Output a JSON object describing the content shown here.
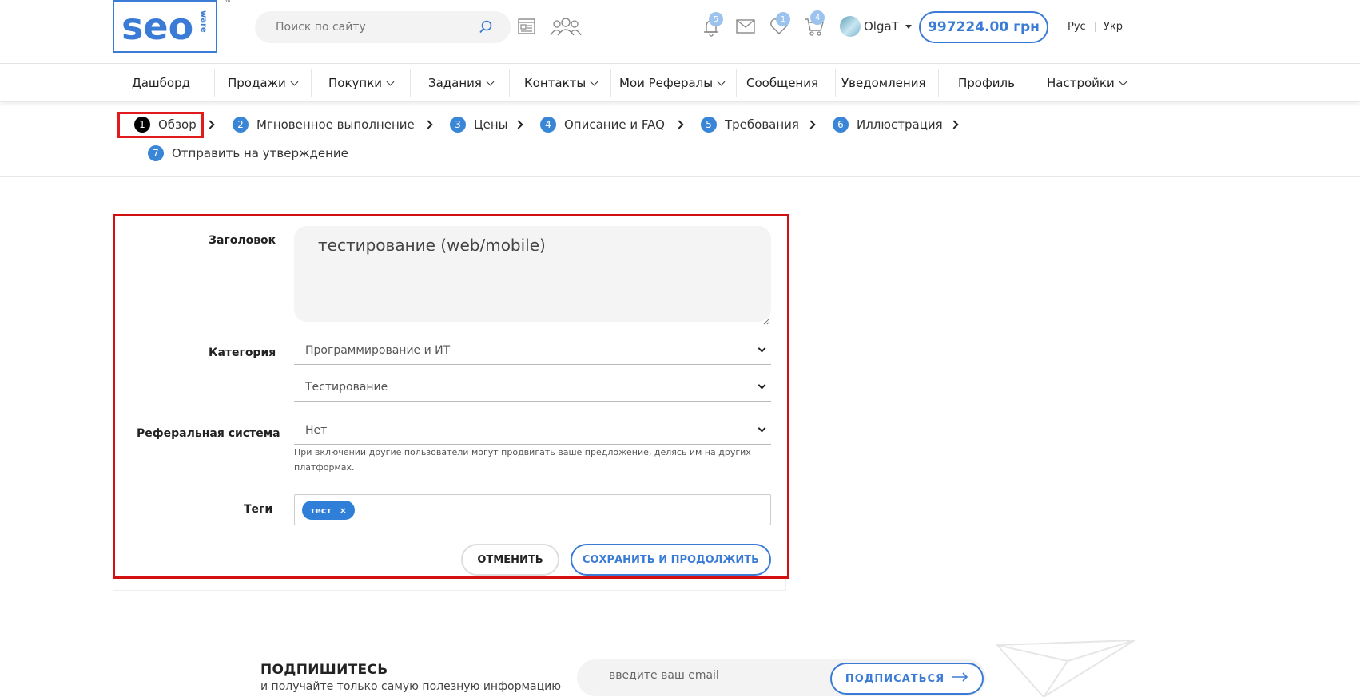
{
  "header": {
    "logo_text": "seo",
    "logo_sub": "ware",
    "logo_tm": "™",
    "search_placeholder": "Поиск по сайту",
    "notifications_count": "5",
    "favorites_count": "1",
    "cart_count": "4",
    "username": "OlgaT",
    "balance": "997224.00 грн",
    "lang_ru": "Рус",
    "lang_uk": "Укр"
  },
  "nav": {
    "items": [
      {
        "label": "Дашборд"
      },
      {
        "label": "Продажи"
      },
      {
        "label": "Покупки"
      },
      {
        "label": "Задания"
      },
      {
        "label": "Контакты"
      },
      {
        "label": "Мои Рефералы"
      },
      {
        "label": "Сообщения"
      },
      {
        "label": "Уведомления"
      },
      {
        "label": "Профиль"
      },
      {
        "label": "Настройки"
      }
    ]
  },
  "steps": [
    {
      "num": "1",
      "label": "Обзор"
    },
    {
      "num": "2",
      "label": "Мгновенное выполнение"
    },
    {
      "num": "3",
      "label": "Цены"
    },
    {
      "num": "4",
      "label": "Описание и FAQ"
    },
    {
      "num": "5",
      "label": "Требования"
    },
    {
      "num": "6",
      "label": "Иллюстрация"
    },
    {
      "num": "7",
      "label": "Отправить на утверждение"
    }
  ],
  "form": {
    "title_label": "Заголовок",
    "title_value": "тестирование (web/mobile)",
    "category_label": "Категория",
    "category_value": "Программирование и ИТ",
    "subcategory_value": "Тестирование",
    "referral_label": "Реферальная система",
    "referral_value": "Нет",
    "referral_hint": "При включении другие пользователи могут продвигать ваше предложение, делясь им на других платформах.",
    "tags_label": "Теги",
    "tags": [
      {
        "label": "тест",
        "remove": "×"
      }
    ],
    "cancel_label": "ОТМЕНИТЬ",
    "save_label": "СОХРАНИТЬ И ПРОДОЛЖИТЬ"
  },
  "footer": {
    "subscribe_title": "ПОДПИШИТЕСЬ",
    "subscribe_text": "и получайте только самую полезную информацию",
    "email_placeholder": "введите ваш email",
    "subscribe_button": "ПОДПИСАТЬСЯ"
  },
  "colors": {
    "accent": "#3a7bd5",
    "highlight": "#d40f0f",
    "step_badge": "#3a86d6"
  }
}
